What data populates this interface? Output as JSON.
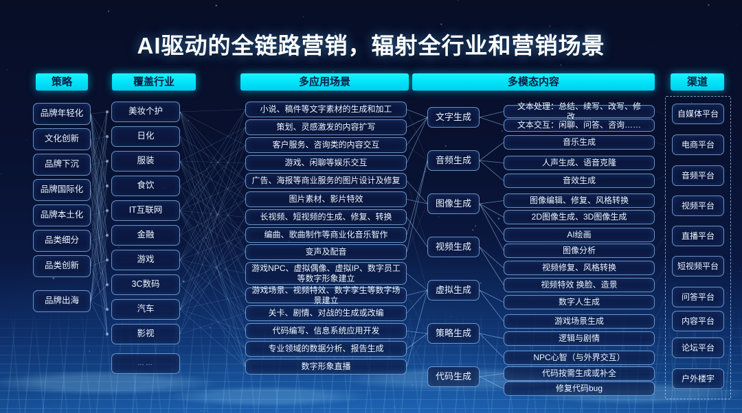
{
  "page": {
    "title": "AI驱动的全链路营销，辐射全行业和营销场景",
    "accent_cyan": "#00e2f7",
    "bg_dark_navy": "#081029",
    "node_border": "#91c8ff"
  },
  "columns": [
    {
      "id": "strategy",
      "header": "策略",
      "items": [
        "品牌年轻化",
        "文化创新",
        "品牌下沉",
        "品牌国际化",
        "品牌本土化",
        "品类细分",
        "品类创新",
        "品牌出海"
      ]
    },
    {
      "id": "industries",
      "header": "覆盖行业",
      "items": [
        "美妆个护",
        "日化",
        "服装",
        "食饮",
        "IT互联网",
        "金融",
        "游戏",
        "3C数码",
        "汽车",
        "影视",
        "……"
      ]
    },
    {
      "id": "scenarios",
      "header": "多应用场景",
      "items": [
        "小说、稿件等文字素材的生成和加工",
        "策划、灵感激发的内容扩写",
        "客户服务、咨询类的内容交互",
        "游戏、闲聊等娱乐交互",
        "广告、海报等商业服务的图片设计及修复",
        "图片素材、影片特效",
        "长视频、短视频的生成、修复、转换",
        "编曲、歌曲制作等商业化音乐智作",
        "变声及配音",
        "游戏NPC、虚拟偶像、虚拟IP、数字员工等数字形象建立",
        "游戏场景、视频特效、数字孪生等数字场景建立",
        "关卡、剧情、对战的生成或改编",
        "代码编写、信息系统应用开发",
        "专业领域的数据分析、报告生成",
        "数字形象直播"
      ]
    },
    {
      "id": "generation-types",
      "header": "",
      "items": [
        "文字生成",
        "音频生成",
        "图像生成",
        "视频生成",
        "虚拟生成",
        "策略生成",
        "代码生成"
      ]
    },
    {
      "id": "multimodal",
      "header": "多模态内容",
      "items": [
        "文本处理：总结、续写、改写、修改……",
        "文本交互：闲聊、问答、咨询……",
        "音乐生成",
        "人声生成、语音克隆",
        "音效生成",
        "图像编辑、修复、风格转换",
        "2D图像生成、3D图像生成",
        "AI绘画",
        "图像分析",
        "视频修复、风格转换",
        "视频特效 换脸、造景",
        "数字人生成",
        "游戏场景生成",
        "逻辑与剧情",
        "NPC心智（与外界交互）",
        "代码按需生成或补全",
        "修复代码bug"
      ]
    },
    {
      "id": "channels",
      "header": "渠道",
      "items": [
        "自媒体平台",
        "电商平台",
        "音频平台",
        "视频平台",
        "直播平台",
        "短视频平台",
        "问答平台",
        "内容平台",
        "论坛平台",
        "户外楼宇"
      ]
    }
  ]
}
